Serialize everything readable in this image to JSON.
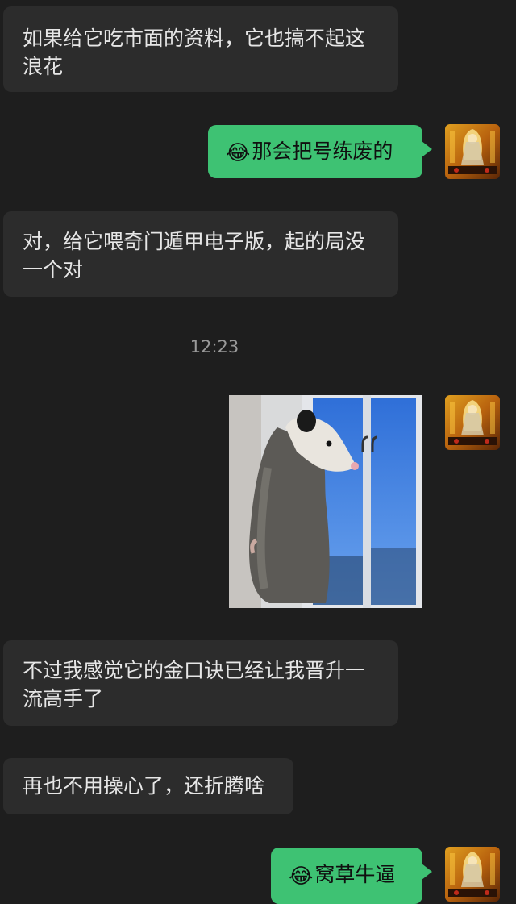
{
  "messages": {
    "m1": "如果给它吃市面的资料，它也搞不起这浪花",
    "m2_emoji": "😂",
    "m2": "那会把号练废的",
    "m3": "对，给它喂奇门遁甲电子版，起的局没一个对",
    "timestamp": "12:23",
    "m5": "不过我感觉它的金口诀已经让我晋升一流高手了",
    "m6": "再也不用操心了，还折腾啥",
    "m7_emoji": "😂",
    "m7": "窝草牛逼"
  },
  "colors": {
    "background": "#1e1e1e",
    "incoming_bubble": "#2c2c2c",
    "outgoing_bubble": "#3ec273"
  }
}
